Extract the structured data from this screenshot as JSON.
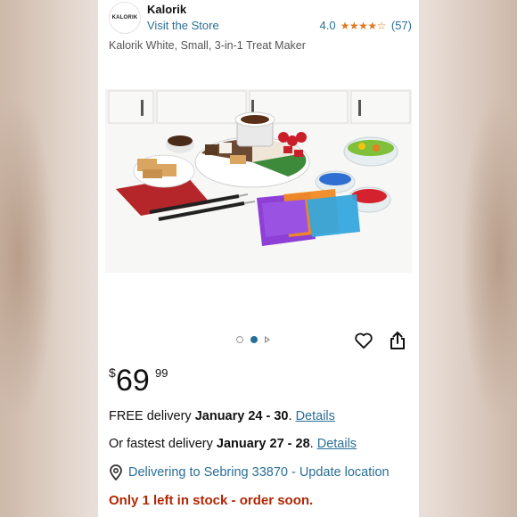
{
  "store": {
    "logo_text": "KALORIK",
    "brand": "Kalorik",
    "visit_link": "Visit the Store",
    "rating": "4.0",
    "rating_value": 4.0,
    "stars": "★★★★☆",
    "review_count": "(57)"
  },
  "product": {
    "title": "Kalorik White, Small, 3-in-1 Treat Maker",
    "image_name": "treat-maker-product-photo"
  },
  "carousel": {
    "total": 2,
    "active_index": 1
  },
  "actions": {
    "wishlist_icon": "heart-icon",
    "share_icon": "share-icon"
  },
  "price": {
    "currency": "$",
    "whole": "69",
    "fraction": "99"
  },
  "delivery": {
    "free_prefix": "FREE delivery ",
    "free_dates": "January 24 - 30",
    "free_sep": ". ",
    "free_link": "Details",
    "fast_prefix": "Or fastest delivery ",
    "fast_dates": "January 27 - 28",
    "fast_sep": ". ",
    "fast_link": "Details",
    "location": "Delivering to Sebring 33870 - Update location"
  },
  "stock": {
    "message": "Only 1 left in stock - order soon."
  },
  "colors": {
    "link": "#2a6f97",
    "star": "#de7921",
    "stock": "#b12704"
  }
}
